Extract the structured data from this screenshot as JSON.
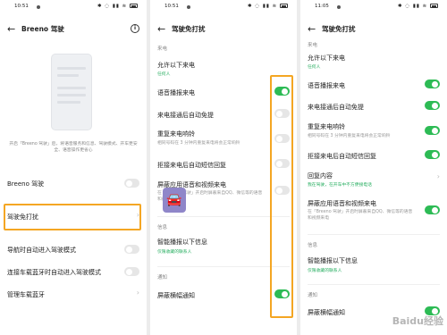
{
  "panel1": {
    "status_time": "10:51",
    "status_icons": "✱ ◌ ▮▮ ≋",
    "title": "Breeno 驾驶",
    "description": "开启「Breeno 驾驶」后，将语音服务和信息、驾驶模式、开车更安全、语音操作更省心",
    "rows": [
      {
        "label": "Breeno 驾驶"
      },
      {
        "label": "驾驶免打扰"
      },
      {
        "label": "导航时自动进入驾驶模式"
      },
      {
        "label": "连接车载蓝牙时自动进入驾驶模式"
      },
      {
        "label": "管理车载蓝牙"
      }
    ]
  },
  "panel2": {
    "status_time": "10:51",
    "status_icons": "✱ ◌ ▮▮ ≋",
    "title": "驾驶免打扰",
    "section_calls": "来电",
    "allow_calls_label": "允许以下来电",
    "allow_calls_value": "任何人",
    "voice_broadcast": "语音播报来电",
    "auto_speaker": "来电接通后自动免提",
    "repeat_ring_label": "重复来电响铃",
    "repeat_ring_sub": "相同号码在 3 分钟内重复来电将会正常响铃",
    "reject_sms": "拒接来电后自动短信回复",
    "block_app_label": "屏蔽应用语音和视频来电",
    "block_app_sub": "在「Breeno 驾驶」开启时屏蔽来自QQ、微信等的语音和视频来电",
    "section_info": "信息",
    "smart_info_label": "智能播报以下信息",
    "smart_info_value": "仅限收藏的联系人",
    "section_notify": "通知",
    "block_banner": "屏蔽横幅通知"
  },
  "panel3": {
    "status_time": "11:05",
    "status_icons": "✱ ◌ ▮▮ ≋",
    "title": "驾驶免打扰",
    "section_calls": "来电",
    "allow_calls_label": "允许以下来电",
    "allow_calls_value": "任何人",
    "voice_broadcast": "语音播报来电",
    "auto_speaker": "来电接通后自动免提",
    "repeat_ring_label": "重复来电响铃",
    "repeat_ring_sub": "相同号码在 3 分钟内重复来电将会正常响铃",
    "reject_sms": "拒接来电后自动短信回复",
    "reply_content_label": "回复内容",
    "reply_content_value": "我在驾驶，在开车中不方便接电话",
    "block_app_label": "屏蔽应用语音和视频来电",
    "block_app_sub": "在「Breeno 驾驶」开启时屏蔽来自QQ、微信等的语音和视频来电",
    "section_info": "信息",
    "smart_info_label": "智能播报以下信息",
    "smart_info_value": "仅限收藏的联系人",
    "section_notify": "通知",
    "block_banner": "屏蔽横幅通知"
  },
  "colors": {
    "toggle_on": "#2dbb55",
    "toggle_off": "#e6e6e6",
    "highlight": "#f4a623",
    "link_green": "#27ae60"
  },
  "watermark": "Baidu经验"
}
